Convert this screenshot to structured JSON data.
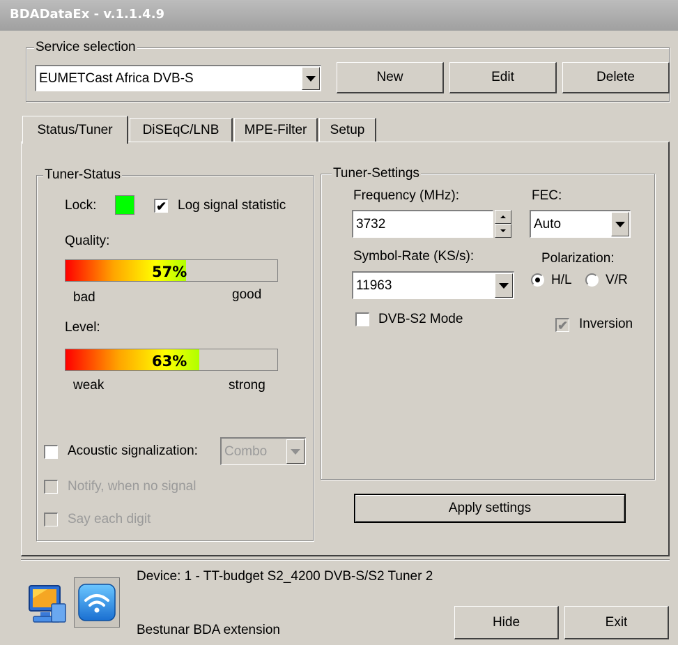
{
  "window": {
    "title": "BDADataEx - v.1.1.4.9"
  },
  "service": {
    "group_label": "Service selection",
    "selected": "EUMETCast Africa DVB-S",
    "new_label": "New",
    "edit_label": "Edit",
    "delete_label": "Delete"
  },
  "tabs": [
    "Status/Tuner",
    "DiSEqC/LNB",
    "MPE-Filter",
    "Setup"
  ],
  "tuner_status": {
    "group_label": "Tuner-Status",
    "lock_label": "Lock:",
    "lock_color": "#00ff00",
    "log_label": "Log signal statistic",
    "log_checked": true,
    "quality_label": "Quality:",
    "quality_value": "57%",
    "quality_fraction": 0.57,
    "quality_low": "bad",
    "quality_high": "good",
    "level_label": "Level:",
    "level_value": "63%",
    "level_fraction": 0.63,
    "level_low": "weak",
    "level_high": "strong",
    "acoustic_label": "Acoustic signalization:",
    "acoustic_select": "Combo",
    "notify_label": "Notify, when no signal",
    "say_digit_label": "Say each digit"
  },
  "tuner_settings": {
    "group_label": "Tuner-Settings",
    "frequency_label": "Frequency (MHz):",
    "frequency_value": "3732",
    "fec_label": "FEC:",
    "fec_value": "Auto",
    "symbol_rate_label": "Symbol-Rate (KS/s):",
    "symbol_rate_value": "11963",
    "polarization_label": "Polarization:",
    "pol_hl": "H/L",
    "pol_vr": "V/R",
    "dvbs2_label": "DVB-S2 Mode",
    "inversion_label": "Inversion",
    "apply_label": "Apply settings"
  },
  "footer": {
    "device": "Device: 1 - TT-budget S2_4200 DVB-S/S2 Tuner 2",
    "extension": "Bestunar BDA extension",
    "hide_label": "Hide",
    "exit_label": "Exit"
  }
}
